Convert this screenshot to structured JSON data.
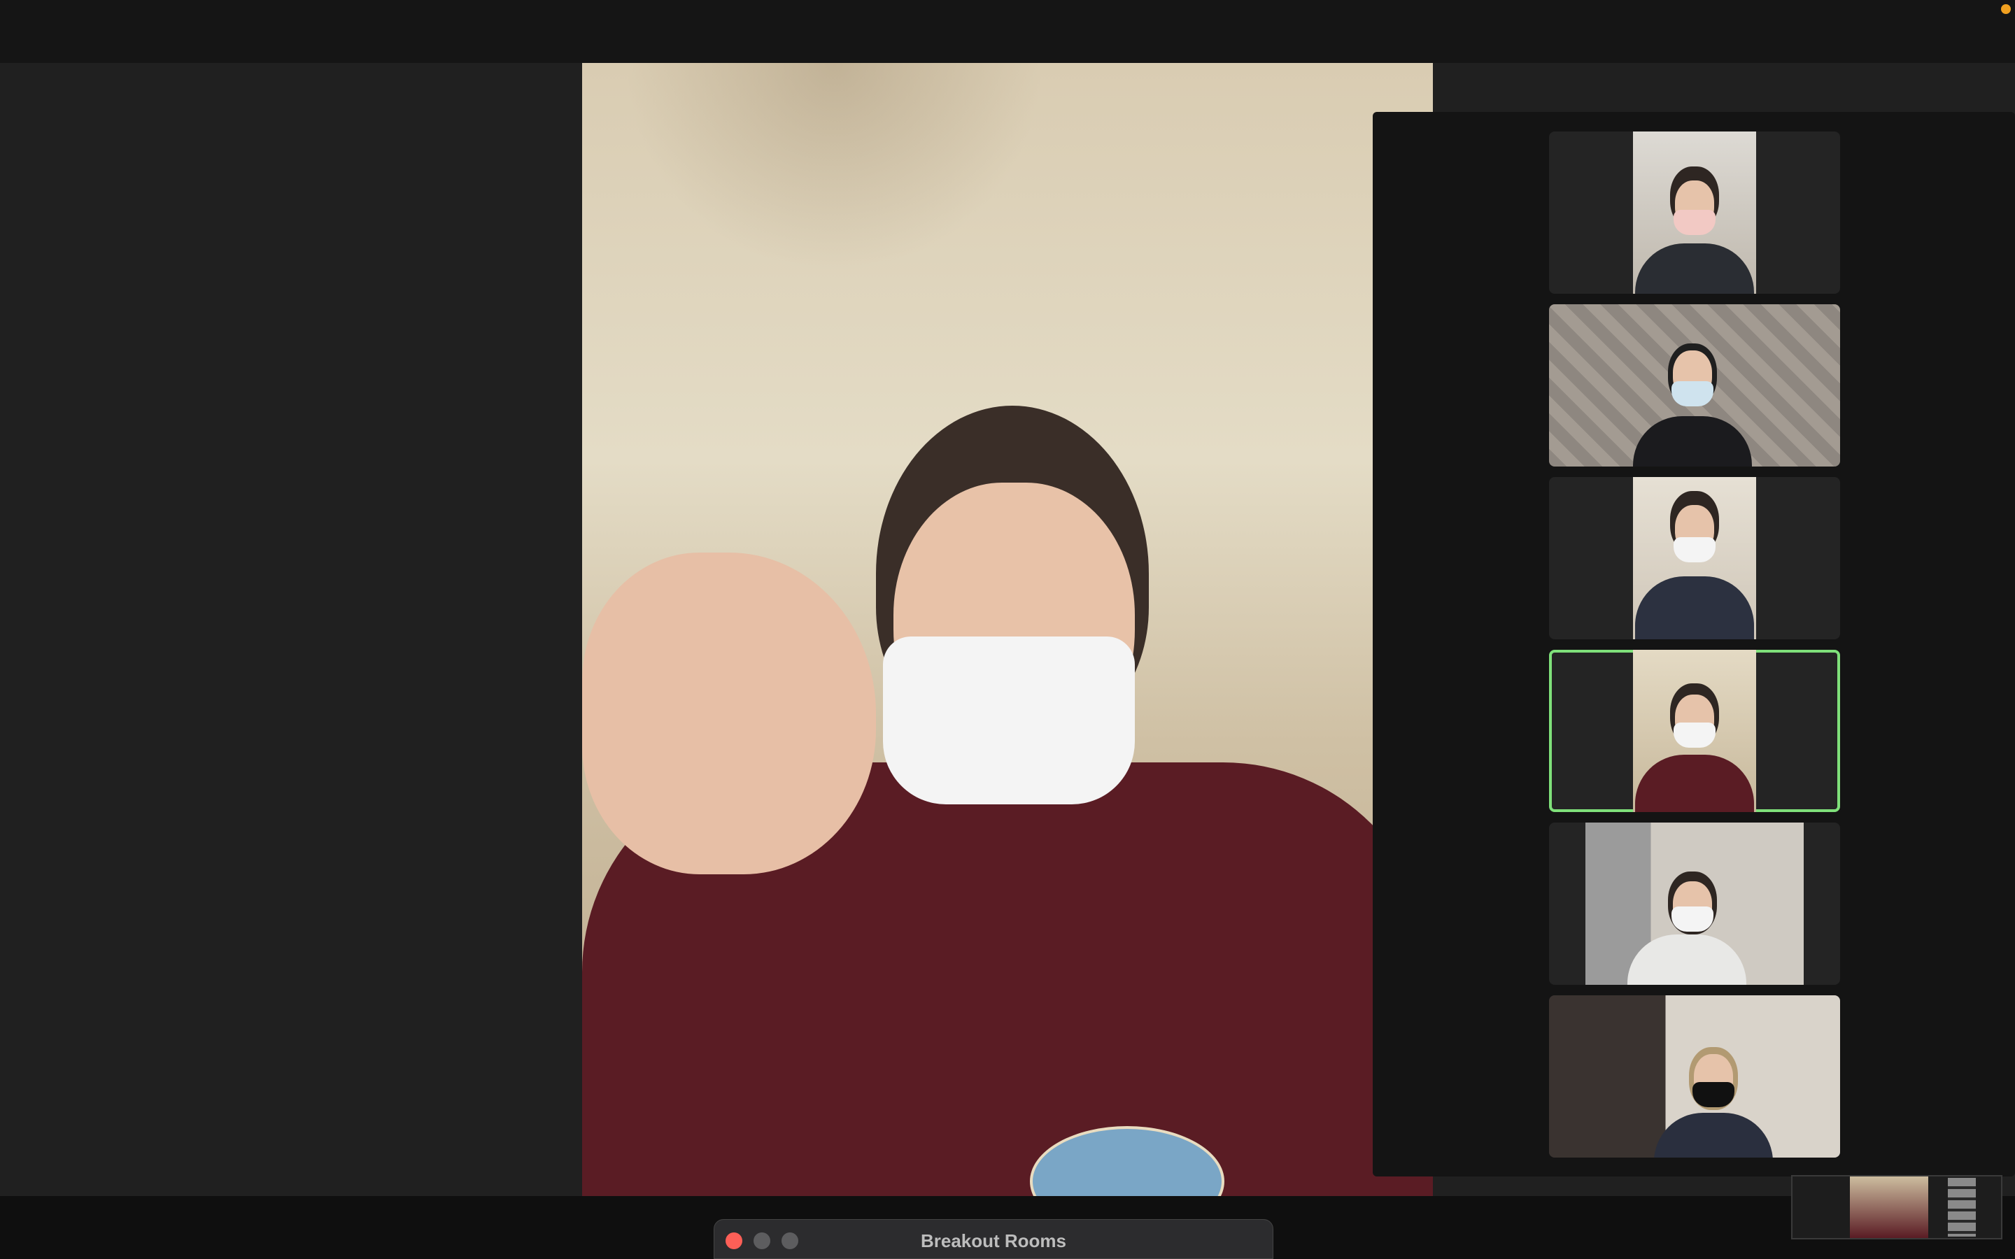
{
  "window": {
    "breakout_title": "Breakout Rooms"
  },
  "meeting": {
    "gallery_participants": [
      {
        "slot": 1,
        "active": false
      },
      {
        "slot": 2,
        "active": false
      },
      {
        "slot": 3,
        "active": false
      },
      {
        "slot": 4,
        "active": true
      },
      {
        "slot": 5,
        "active": false
      },
      {
        "slot": 6,
        "active": false
      }
    ]
  },
  "colors": {
    "active_speaker_border": "#7fe07a",
    "close_button": "#fe5f57",
    "recording_indicator": "#f0a020"
  }
}
